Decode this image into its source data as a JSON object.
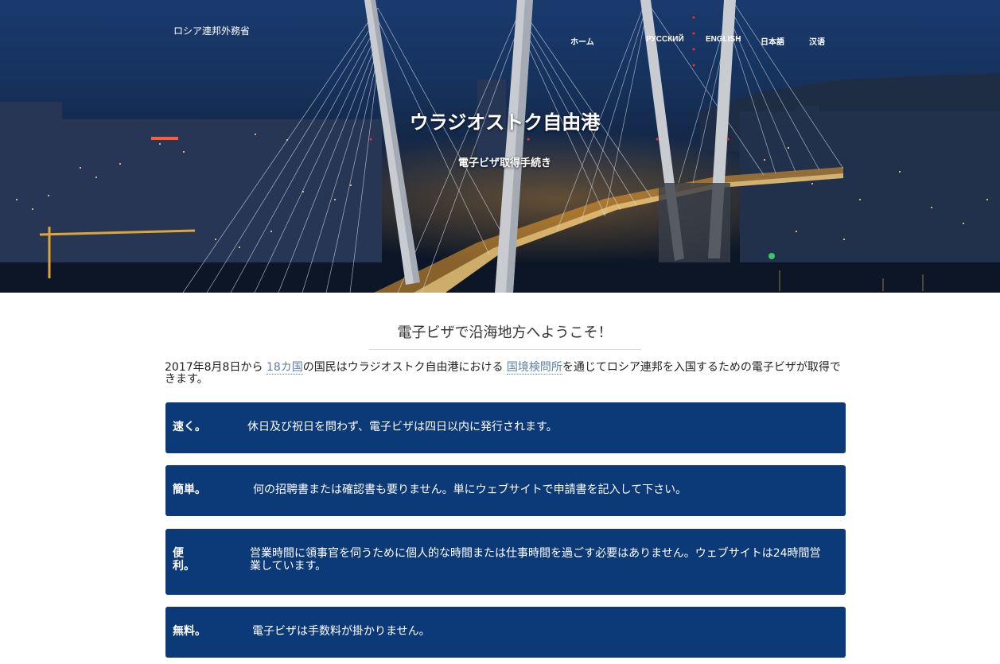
{
  "header": {
    "ministry": "ロシア連邦外務省",
    "nav": [
      "ホーム",
      "РУССКИЙ",
      "ENGLISH",
      "日本語",
      "汉语"
    ],
    "title": "ウラジオストク自由港",
    "subtitle": "電子ビザ取得手続き"
  },
  "main": {
    "welcome": "電子ビザで沿海地方へようこそ！",
    "intro": {
      "part1": "2017年8月8日から",
      "link1": "18カ国",
      "part2": "の国民はウラジオストク自由港における",
      "link2": "国境検問所",
      "part3": "を通じてロシア連邦を入国するための電子ビザが取得できます。"
    },
    "features": [
      {
        "label": "速く。",
        "text": "休日及び祝日を問わず、電子ビザは四日以内に発行されます。"
      },
      {
        "label": "簡単。",
        "text": "何の招聘書または確認書も要りません。単にウェブサイトで申請書を記入して下さい。"
      },
      {
        "label": "便利。",
        "text": "営業時間に領事官を伺うために個人的な時間または仕事時間を過ごす必要はありません。ウェブサイトは24時間営業しています。"
      },
      {
        "label": "無料。",
        "text": "電子ビザは手数料が掛かりません。"
      }
    ]
  },
  "colors": {
    "feature_box": "#0c3977",
    "link": "#5a7fa8"
  }
}
